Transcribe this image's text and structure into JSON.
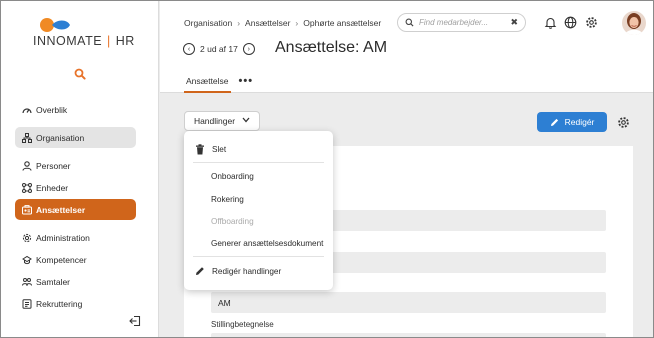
{
  "brand": {
    "name_left": "INNOMATE",
    "separator": "|",
    "name_right": "HR",
    "accent": "#d0651b",
    "logo_blue": "#2d7fd3",
    "logo_orange": "#f08a24"
  },
  "sidebar": {
    "items": [
      {
        "label": "Overblik",
        "icon": "dashboard-icon"
      },
      {
        "label": "Organisation",
        "icon": "org-chart-icon"
      },
      {
        "label": "Personer",
        "icon": "person-icon"
      },
      {
        "label": "Enheder",
        "icon": "units-icon"
      },
      {
        "label": "Ansættelser",
        "icon": "employment-icon",
        "active": true
      },
      {
        "label": "Administration",
        "icon": "admin-gear-icon"
      },
      {
        "label": "Kompetencer",
        "icon": "competence-icon"
      },
      {
        "label": "Samtaler",
        "icon": "conversation-icon"
      },
      {
        "label": "Rekruttering",
        "icon": "recruit-icon"
      }
    ]
  },
  "header": {
    "breadcrumbs": [
      "Organisation",
      "Ansættelser",
      "Ophørte ansættelser"
    ],
    "search_placeholder": "Find medarbejder...",
    "pager": {
      "text": "2 ud af 17"
    },
    "title": "Ansættelse: AM",
    "tabs": [
      "Ansættelse"
    ],
    "more": "•••"
  },
  "toolbar": {
    "actions_label": "Handlinger",
    "edit_label": "Redigér"
  },
  "dropdown": {
    "items": [
      {
        "label": "Slet",
        "icon": "trash-icon"
      },
      {
        "label": "Onboarding"
      },
      {
        "label": "Rokering"
      },
      {
        "label": "Offboarding",
        "disabled": true
      },
      {
        "label": "Generer ansættelsesdokument"
      },
      {
        "label": "Redigér handlinger",
        "icon": "pencil-icon"
      }
    ]
  },
  "form": {
    "initials_value": "AM",
    "job_title_label": "Stillingbetegnelse"
  }
}
